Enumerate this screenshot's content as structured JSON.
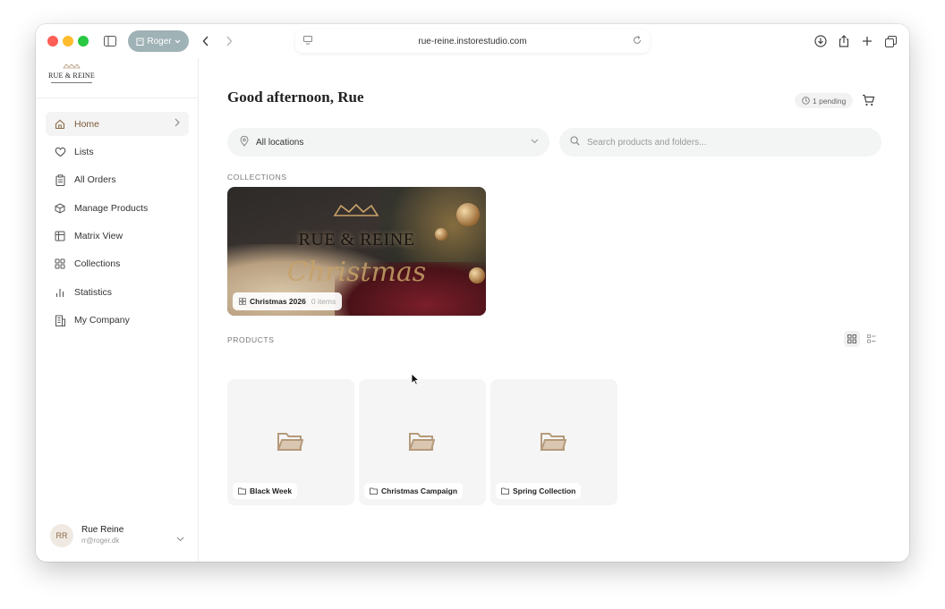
{
  "browser": {
    "profile_label": "Roger",
    "url": "rue-reine.instorestudio.com"
  },
  "brand": {
    "logo_text": "RUE & REINE"
  },
  "sidebar": {
    "items": [
      {
        "label": "Home",
        "icon": "home-icon",
        "active": true
      },
      {
        "label": "Lists",
        "icon": "heart-icon"
      },
      {
        "label": "All Orders",
        "icon": "clipboard-icon"
      },
      {
        "label": "Manage Products",
        "icon": "box-icon"
      },
      {
        "label": "Matrix View",
        "icon": "table-icon"
      },
      {
        "label": "Collections",
        "icon": "grid-icon"
      },
      {
        "label": "Statistics",
        "icon": "bar-chart-icon"
      },
      {
        "label": "My Company",
        "icon": "building-icon"
      }
    ],
    "user": {
      "initials": "RR",
      "name": "Rue Reine",
      "email": "rr@roger.dk"
    }
  },
  "main": {
    "greeting": "Good afternoon, Rue",
    "pending_badge": "1 pending",
    "location_select": "All locations",
    "search_placeholder": "Search products and folders...",
    "collections_label": "COLLECTIONS",
    "collection": {
      "brand_text": "RUE & REINE",
      "script_text": "Christmas",
      "name": "Christmas 2026",
      "count": "0 items"
    },
    "products_label": "PRODUCTS",
    "folders": [
      {
        "name": "Black Week"
      },
      {
        "name": "Christmas Campaign"
      },
      {
        "name": "Spring Collection"
      }
    ]
  },
  "colors": {
    "accent": "#8a6a48",
    "profile_pill": "#9fb2b5"
  }
}
